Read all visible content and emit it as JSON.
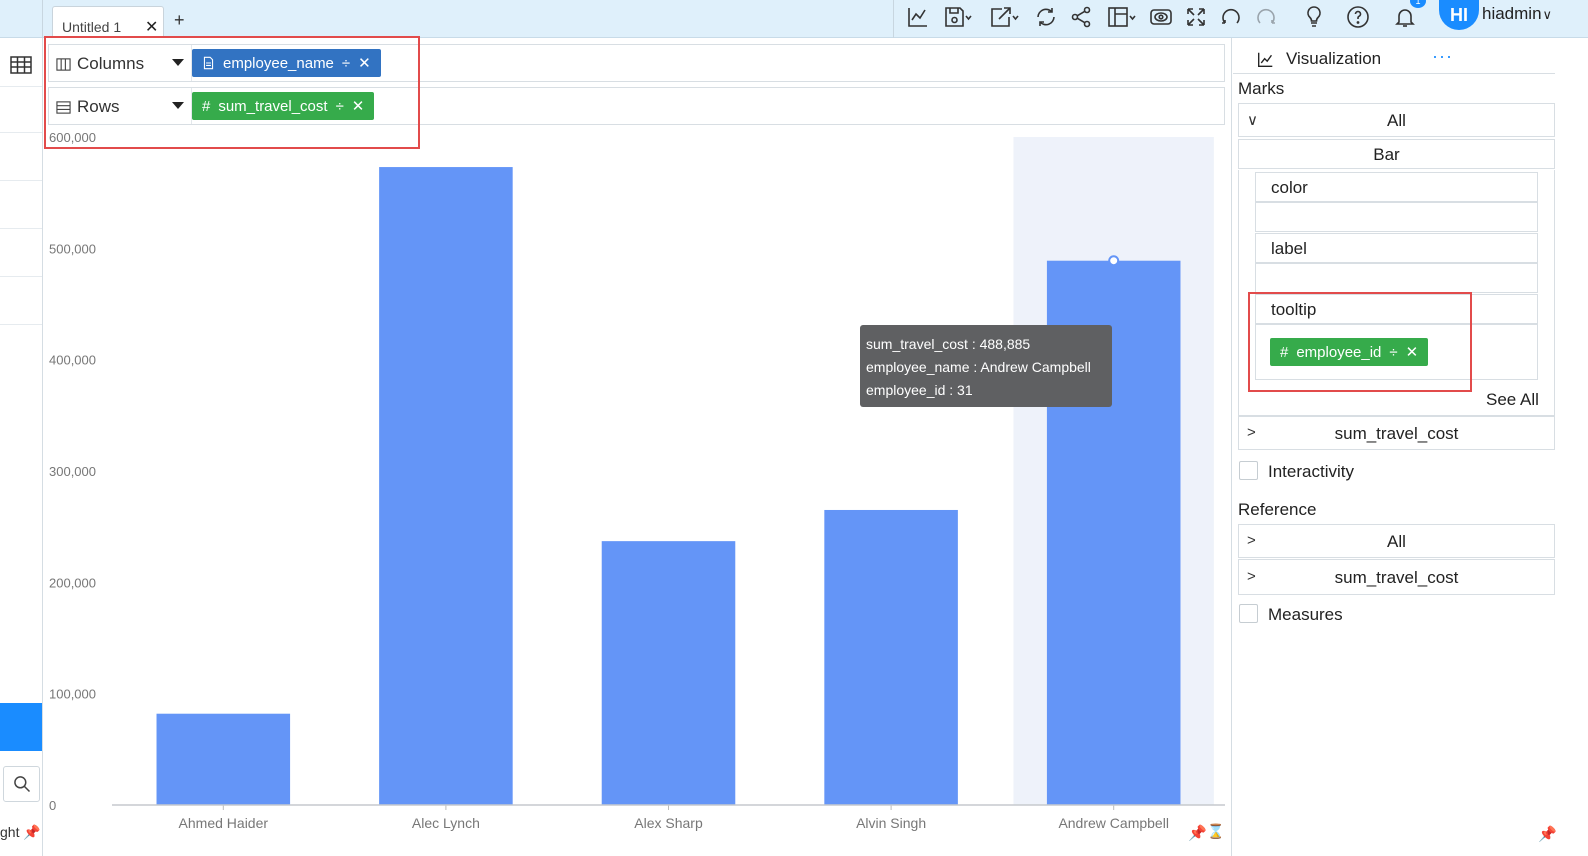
{
  "tab": {
    "title": "Untitled 1",
    "close_symbol": "✕",
    "add_symbol": "+"
  },
  "user": {
    "initials": "HI",
    "name": "hiadmin",
    "notification_count": "1"
  },
  "toolbar": {
    "icons": [
      "line-chart-icon",
      "save-icon",
      "export-icon",
      "refresh-icon",
      "share-icon",
      "layout-icon",
      "preview-icon",
      "fullscreen-icon",
      "undo-icon",
      "redo-icon",
      "lightbulb-icon",
      "help-icon",
      "bell-icon"
    ]
  },
  "shelves": {
    "columns": {
      "label": "Columns",
      "pill": "employee_name"
    },
    "rows": {
      "label": "Rows",
      "pill": "sum_travel_cost"
    }
  },
  "left_sidebar": {
    "bottom_text": "ght"
  },
  "tooltip": {
    "line1": "sum_travel_cost : 488,885",
    "line2": "employee_name : Andrew Campbell",
    "line3": "employee_id : 31"
  },
  "right_panel": {
    "title": "Visualization",
    "dots": "···",
    "marks_label": "Marks",
    "marks_all": "All",
    "mark_type": "Bar",
    "color_label": "color",
    "label_label": "label",
    "tooltip_label": "tooltip",
    "tooltip_pill": "employee_id",
    "see_all": "See All",
    "measure_row": "sum_travel_cost",
    "interactivity_label": "Interactivity",
    "reference_label": "Reference",
    "reference_all": "All",
    "reference_measure": "sum_travel_cost",
    "measures_label": "Measures"
  },
  "colors": {
    "bar": "#6495f7",
    "highlight_band": "#eef2fa",
    "accent": "#1a8cff",
    "pill_blue": "#3273c2",
    "pill_green": "#36ab4b",
    "callout_red": "#e24b4b"
  },
  "chart_data": {
    "type": "bar",
    "categories": [
      "Ahmed Haider",
      "Alec Lynch",
      "Alex Sharp",
      "Alvin Singh",
      "Andrew Campbell"
    ],
    "values": [
      82000,
      573000,
      237000,
      265000,
      488885
    ],
    "ylim": [
      0,
      600000
    ],
    "yticks": [
      "0",
      "100,000",
      "200,000",
      "300,000",
      "400,000",
      "500,000",
      "600,000"
    ],
    "ytick_values": [
      0,
      100000,
      200000,
      300000,
      400000,
      500000,
      600000
    ],
    "highlighted_category": "Andrew Campbell",
    "grid": false
  }
}
